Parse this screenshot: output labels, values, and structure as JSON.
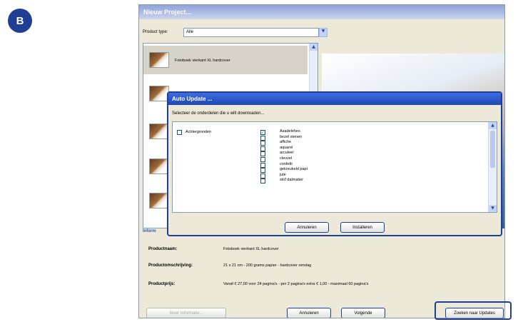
{
  "badge": "B",
  "window": {
    "title": "Nieuw Project...",
    "product_type_label": "Product type:",
    "product_type_value": "Alle",
    "products": [
      {
        "label": "Fotoboek vierkant XL hardcover"
      },
      {
        "label": ""
      },
      {
        "label": ""
      },
      {
        "label": ""
      },
      {
        "label": ""
      }
    ],
    "info_tab": "Inform",
    "info": {
      "name_label": "Productnaam:",
      "name_value": "Fotoboek vierkant XL hardcover",
      "desc_label": "Productomschrijving:",
      "desc_value": "21 x 21 cm - 200 grams papier - hardcover omslag",
      "price_label": "Productprijs:",
      "price_value": "Vanaf € 27,00 voor 24 pagina's - per 2 pagina's extra € 1,00 - maximaal 60 pagina's"
    },
    "buttons": {
      "more_info": "Meer Informatie...",
      "cancel": "Annuleren",
      "next": "Volgende",
      "find_updates": "Zoeken naar Updates"
    }
  },
  "dialog": {
    "title": "Auto Update ...",
    "instruction": "Selecteer de onderdelen die u wilt downloaden...",
    "root_label": "Achtergronden",
    "items": [
      {
        "label": "Asadelehes",
        "checked": true
      },
      {
        "label": "bezel stenen",
        "checked": false
      },
      {
        "label": "affiche",
        "checked": false
      },
      {
        "label": "aquarel",
        "checked": false
      },
      {
        "label": "arcuteel",
        "checked": false
      },
      {
        "label": "cleuvel",
        "checked": false
      },
      {
        "label": "confetti",
        "checked": false
      },
      {
        "label": "gekreukeld papi",
        "checked": false
      },
      {
        "label": "jute",
        "checked": false
      },
      {
        "label": "stof dalmatier",
        "checked": false
      }
    ],
    "cancel": "Annuleren",
    "install": "Installeren"
  },
  "colors": {
    "accent": "#1f3f95",
    "titlebar": "#2a55c8",
    "window_bg": "#ece9d8"
  }
}
